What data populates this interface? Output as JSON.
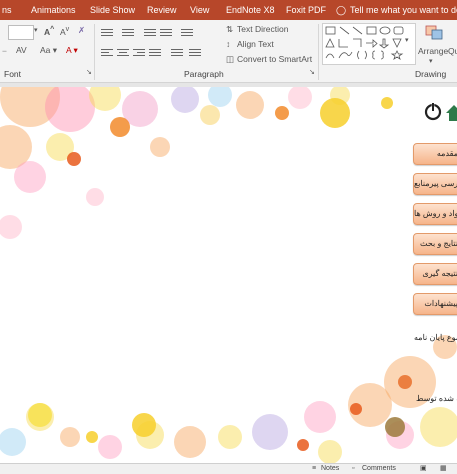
{
  "menu_tabs": [
    "Animations",
    "Slide Show",
    "Review",
    "View",
    "EndNote X8",
    "Foxit PDF"
  ],
  "tell_me": "Tell me what you want to do...",
  "ribbon": {
    "font_group": "Font",
    "paragraph_group": "Paragraph",
    "drawing_group": "Drawing",
    "text_direction": "Text Direction",
    "align_text": "Align Text",
    "convert_smartart": "Convert to SmartArt",
    "arrange": "Arrange",
    "quick_styles_partial": "Qu St"
  },
  "slide": {
    "buttons": [
      "مقدمه",
      "بررسی پیرمنابع",
      "مواد و روش ها",
      "نتایج و بحث",
      "نتیجه گیری",
      "پیشنهادات"
    ],
    "thesis_title_label": "موضوع پایان نامه :",
    "author_label": "تهیه شده توسط :"
  },
  "status": {
    "notes": "Notes",
    "comments": "Comments"
  },
  "colors": {
    "menu_bar": "#b7472a",
    "button_fill": "#f6b48a"
  }
}
